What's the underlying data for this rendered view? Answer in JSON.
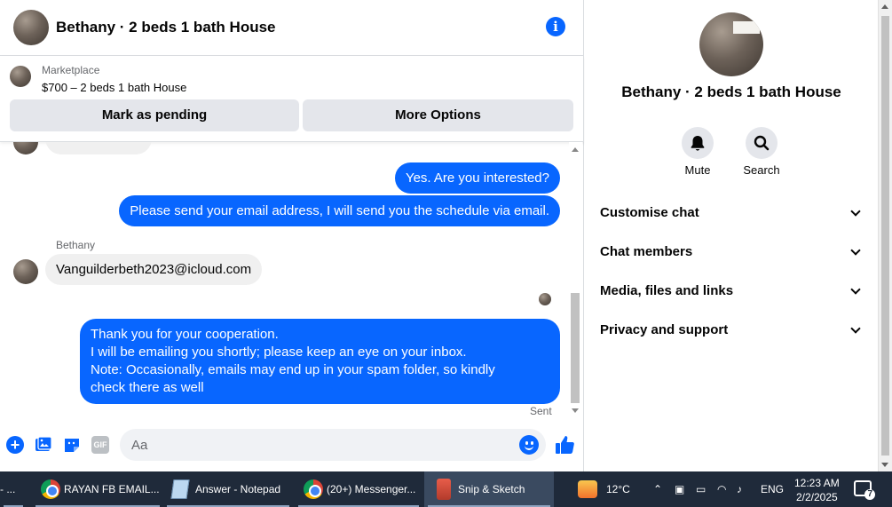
{
  "chat": {
    "title": "Bethany · 2 beds 1 bath House",
    "listing": {
      "label": "Marketplace",
      "price_title": "$700 – 2 beds 1 bath House",
      "mark_pending": "Mark as pending",
      "more_options": "More Options"
    },
    "messages": {
      "out1": "Yes. Are you interested?",
      "out2": "Please send your email address, I will send you the schedule via email.",
      "sender": "Bethany",
      "in1": "Vanguilderbeth2023@icloud.com",
      "out3_lines": [
        "Thank you for your cooperation.",
        "I will be emailing you shortly; please keep an eye on your inbox.",
        "Note: Occasionally, emails may end up in your spam folder, so kindly",
        "check there as well"
      ],
      "status": "Sent"
    },
    "composer": {
      "placeholder": "Aa",
      "gif": "GIF",
      "icons": [
        "plus-icon",
        "photo-icon",
        "sticker-icon",
        "gif-icon",
        "emoji-icon",
        "thumbs-up-icon"
      ]
    }
  },
  "details": {
    "title": "Bethany · 2 beds 1 bath House",
    "actions": [
      {
        "label": "Mute",
        "icon": "bell-icon"
      },
      {
        "label": "Search",
        "icon": "search-icon"
      }
    ],
    "menu": [
      "Customise chat",
      "Chat members",
      "Media, files and links",
      "Privacy and support"
    ]
  },
  "taskbar": {
    "items": [
      {
        "label": "- ..."
      },
      {
        "label": "RAYAN FB EMAIL..."
      },
      {
        "label": "Answer - Notepad"
      },
      {
        "label": "(20+) Messenger..."
      },
      {
        "label": "Snip & Sketch"
      }
    ],
    "weather": "12°C",
    "language": "ENG",
    "time": "12:23 AM",
    "date": "2/2/2025",
    "notifications": "7"
  },
  "colors": {
    "accent": "#0866ff",
    "bubble_in": "#f0f0f0",
    "taskbar": "#1f2a3a"
  }
}
